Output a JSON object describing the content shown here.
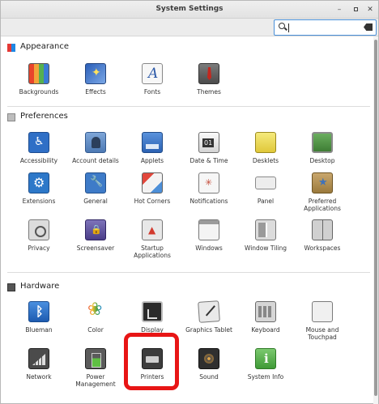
{
  "window": {
    "title": "System Settings",
    "minimize_icon": "minimize-icon",
    "maximize_icon": "maximize-icon",
    "close_icon": "close-icon",
    "close_glyph": "✕",
    "minimize_glyph": "–"
  },
  "search": {
    "value": "",
    "placeholder": ""
  },
  "sections": {
    "appearance": {
      "title": "Appearance",
      "items": [
        {
          "label": "Backgrounds",
          "icon": "backgrounds-icon"
        },
        {
          "label": "Effects",
          "icon": "effects-icon"
        },
        {
          "label": "Fonts",
          "icon": "fonts-icon"
        },
        {
          "label": "Themes",
          "icon": "themes-icon"
        }
      ]
    },
    "preferences": {
      "title": "Preferences",
      "items": [
        {
          "label": "Accessibility",
          "icon": "accessibility-icon"
        },
        {
          "label": "Account details",
          "icon": "account-details-icon"
        },
        {
          "label": "Applets",
          "icon": "applets-icon"
        },
        {
          "label": "Date & Time",
          "icon": "date-time-icon"
        },
        {
          "label": "Desklets",
          "icon": "desklets-icon"
        },
        {
          "label": "Desktop",
          "icon": "desktop-icon"
        },
        {
          "label": "Extensions",
          "icon": "extensions-icon"
        },
        {
          "label": "General",
          "icon": "general-icon"
        },
        {
          "label": "Hot Corners",
          "icon": "hot-corners-icon"
        },
        {
          "label": "Notifications",
          "icon": "notifications-icon"
        },
        {
          "label": "Panel",
          "icon": "panel-icon"
        },
        {
          "label": "Preferred Applications",
          "icon": "preferred-applications-icon"
        },
        {
          "label": "Privacy",
          "icon": "privacy-icon"
        },
        {
          "label": "Screensaver",
          "icon": "screensaver-icon"
        },
        {
          "label": "Startup Applications",
          "icon": "startup-applications-icon"
        },
        {
          "label": "Windows",
          "icon": "windows-icon"
        },
        {
          "label": "Window Tiling",
          "icon": "window-tiling-icon"
        },
        {
          "label": "Workspaces",
          "icon": "workspaces-icon"
        }
      ]
    },
    "hardware": {
      "title": "Hardware",
      "items": [
        {
          "label": "Blueman",
          "icon": "bluetooth-icon"
        },
        {
          "label": "Color",
          "icon": "color-icon"
        },
        {
          "label": "Display",
          "icon": "display-icon"
        },
        {
          "label": "Graphics Tablet",
          "icon": "graphics-tablet-icon"
        },
        {
          "label": "Keyboard",
          "icon": "keyboard-icon"
        },
        {
          "label": "Mouse and Touchpad",
          "icon": "mouse-icon"
        },
        {
          "label": "Network",
          "icon": "network-icon"
        },
        {
          "label": "Power Management",
          "icon": "power-icon"
        },
        {
          "label": "Printers",
          "icon": "printer-icon"
        },
        {
          "label": "Sound",
          "icon": "sound-icon"
        },
        {
          "label": "System Info",
          "icon": "system-info-icon"
        }
      ]
    }
  },
  "highlight_color": "#e81515"
}
